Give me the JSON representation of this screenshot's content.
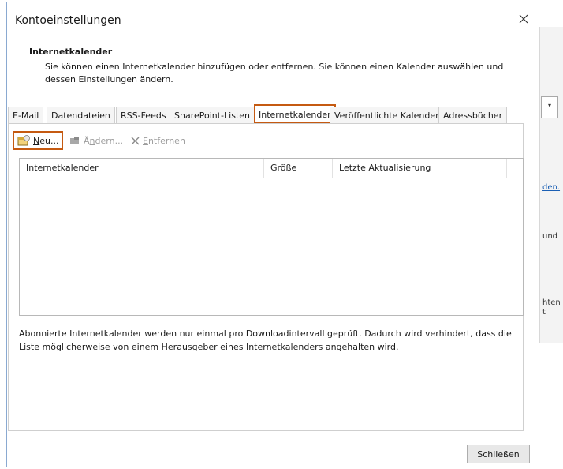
{
  "dialog": {
    "title": "Kontoeinstellungen",
    "heading": "Internetkalender",
    "description": "Sie können einen Internetkalender hinzufügen oder entfernen. Sie können einen Kalender auswählen und dessen Einstellungen ändern.",
    "close_label": "Schließen"
  },
  "tabs": [
    {
      "label": "E-Mail"
    },
    {
      "label": "Datendateien"
    },
    {
      "label": "RSS-Feeds"
    },
    {
      "label": "SharePoint-Listen"
    },
    {
      "label": "Internetkalender",
      "active": true
    },
    {
      "label": "Veröffentlichte Kalender"
    },
    {
      "label": "Adressbücher"
    }
  ],
  "toolbar": {
    "new": {
      "ul": "N",
      "rest": "eu..."
    },
    "change": {
      "pre": "Ä",
      "ul": "n",
      "rest": "dern..."
    },
    "remove": {
      "ul": "E",
      "rest": "ntfernen"
    }
  },
  "list": {
    "columns": [
      "Internetkalender",
      "Größe",
      "Letzte Aktualisierung"
    ],
    "rows": []
  },
  "info_text": "Abonnierte Internetkalender werden nur einmal pro Downloadintervall geprüft. Dadurch wird verhindert, dass die Liste möglicherweise von einem Herausgeber eines Internetkalenders angehalten wird.",
  "background": {
    "link_fragment": "den.",
    "text_fragment_1": "und",
    "text_fragment_2": "hten",
    "text_fragment_3": "t"
  },
  "colors": {
    "highlight": "#c55a11",
    "dialog_border": "#8aa9d1"
  },
  "icons": {
    "close": "close-icon",
    "new": "new-calendar-icon",
    "change": "change-icon",
    "remove": "remove-x-icon"
  }
}
